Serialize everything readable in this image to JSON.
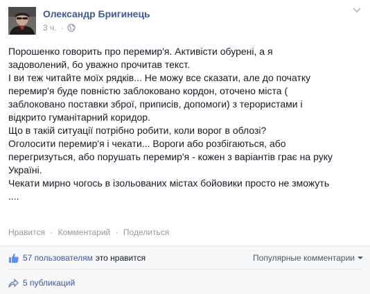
{
  "author": {
    "name": "Олександр Бригинець",
    "time": "3 ч."
  },
  "post": {
    "lines": [
      "Порошенко говорить про перемир'я. Активісти обурені, а я",
      "задоволений, бо уважно прочитав текст.",
      "І ви теж читайте моїх рядків... Не можу все сказати, але до початку",
      "перемир'я буде повністю заблоковано кордон, оточено міста (",
      "заблоковано поставки зброї, приписів, допомоги) з терористами і",
      "відкрито гуманітарний коридор.",
      "Що в такій ситуації потрібно робити, коли ворог в облозі?",
      "Оголосити перемир'я і чекати... Вороги або розбігаються, або",
      "перегризуться, або порушать перемир'я - кожен з варіантів грає на руку",
      "Україні.",
      "Чекати мирно чогось в ізольованих містах бойовики просто не зможуть",
      "...."
    ]
  },
  "actions": {
    "like": "Нравится",
    "comment": "Комментарий",
    "share": "Поделиться",
    "separator": "·"
  },
  "likes": {
    "count_text": "57 пользователям",
    "suffix": "это нравится"
  },
  "sort": {
    "label": "Популярные комментарии"
  },
  "shares": {
    "text": "5 публикаций"
  },
  "colors": {
    "link": "#3b5998",
    "muted": "#9197a3",
    "text": "#141823",
    "panel": "#f6f7f8"
  }
}
